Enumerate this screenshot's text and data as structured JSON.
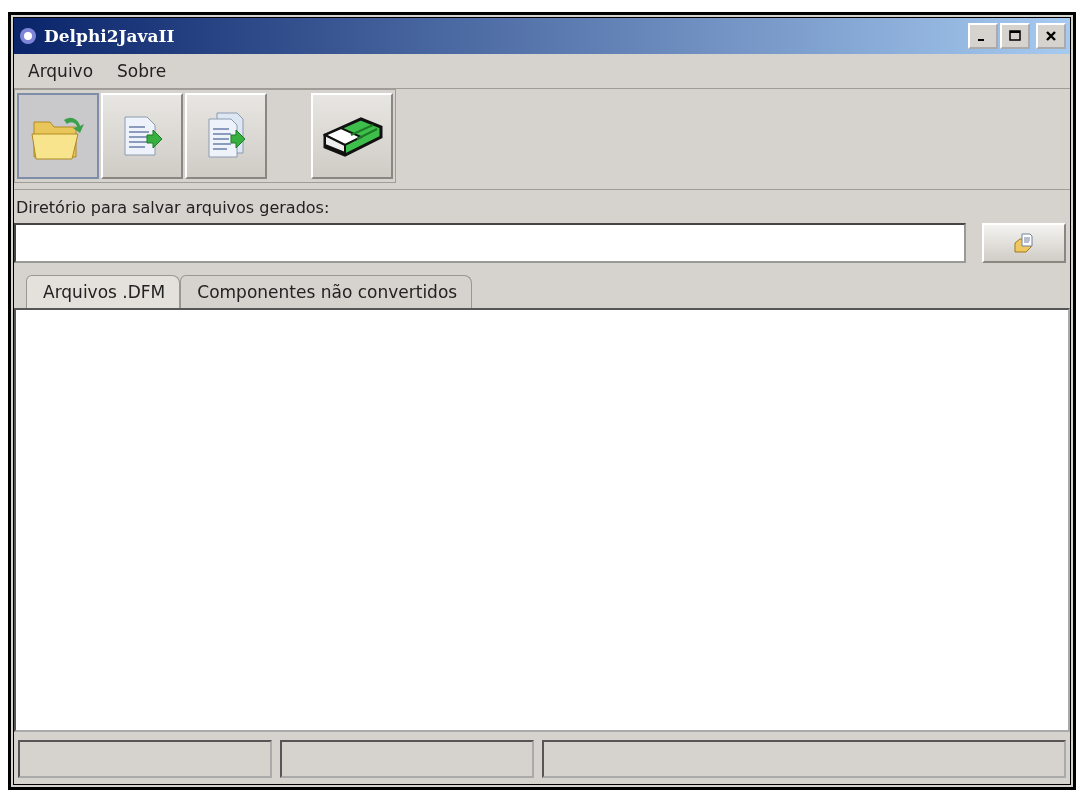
{
  "window": {
    "title": "Delphi2JavaII"
  },
  "menu": [
    "Arquivo",
    "Sobre"
  ],
  "toolbar": [
    {
      "kind": "open",
      "pressed": true
    },
    {
      "kind": "file-convert",
      "pressed": false
    },
    {
      "kind": "files-convert",
      "pressed": false
    },
    {
      "kind": "gap"
    },
    {
      "kind": "eraser",
      "pressed": false
    }
  ],
  "directory": {
    "label": "Diretório para salvar arquivos gerados:"
  },
  "tabs": [
    {
      "label": "Arquivos .DFM",
      "selected": true
    },
    {
      "label": "Componentes não convertidos",
      "selected": false
    }
  ]
}
